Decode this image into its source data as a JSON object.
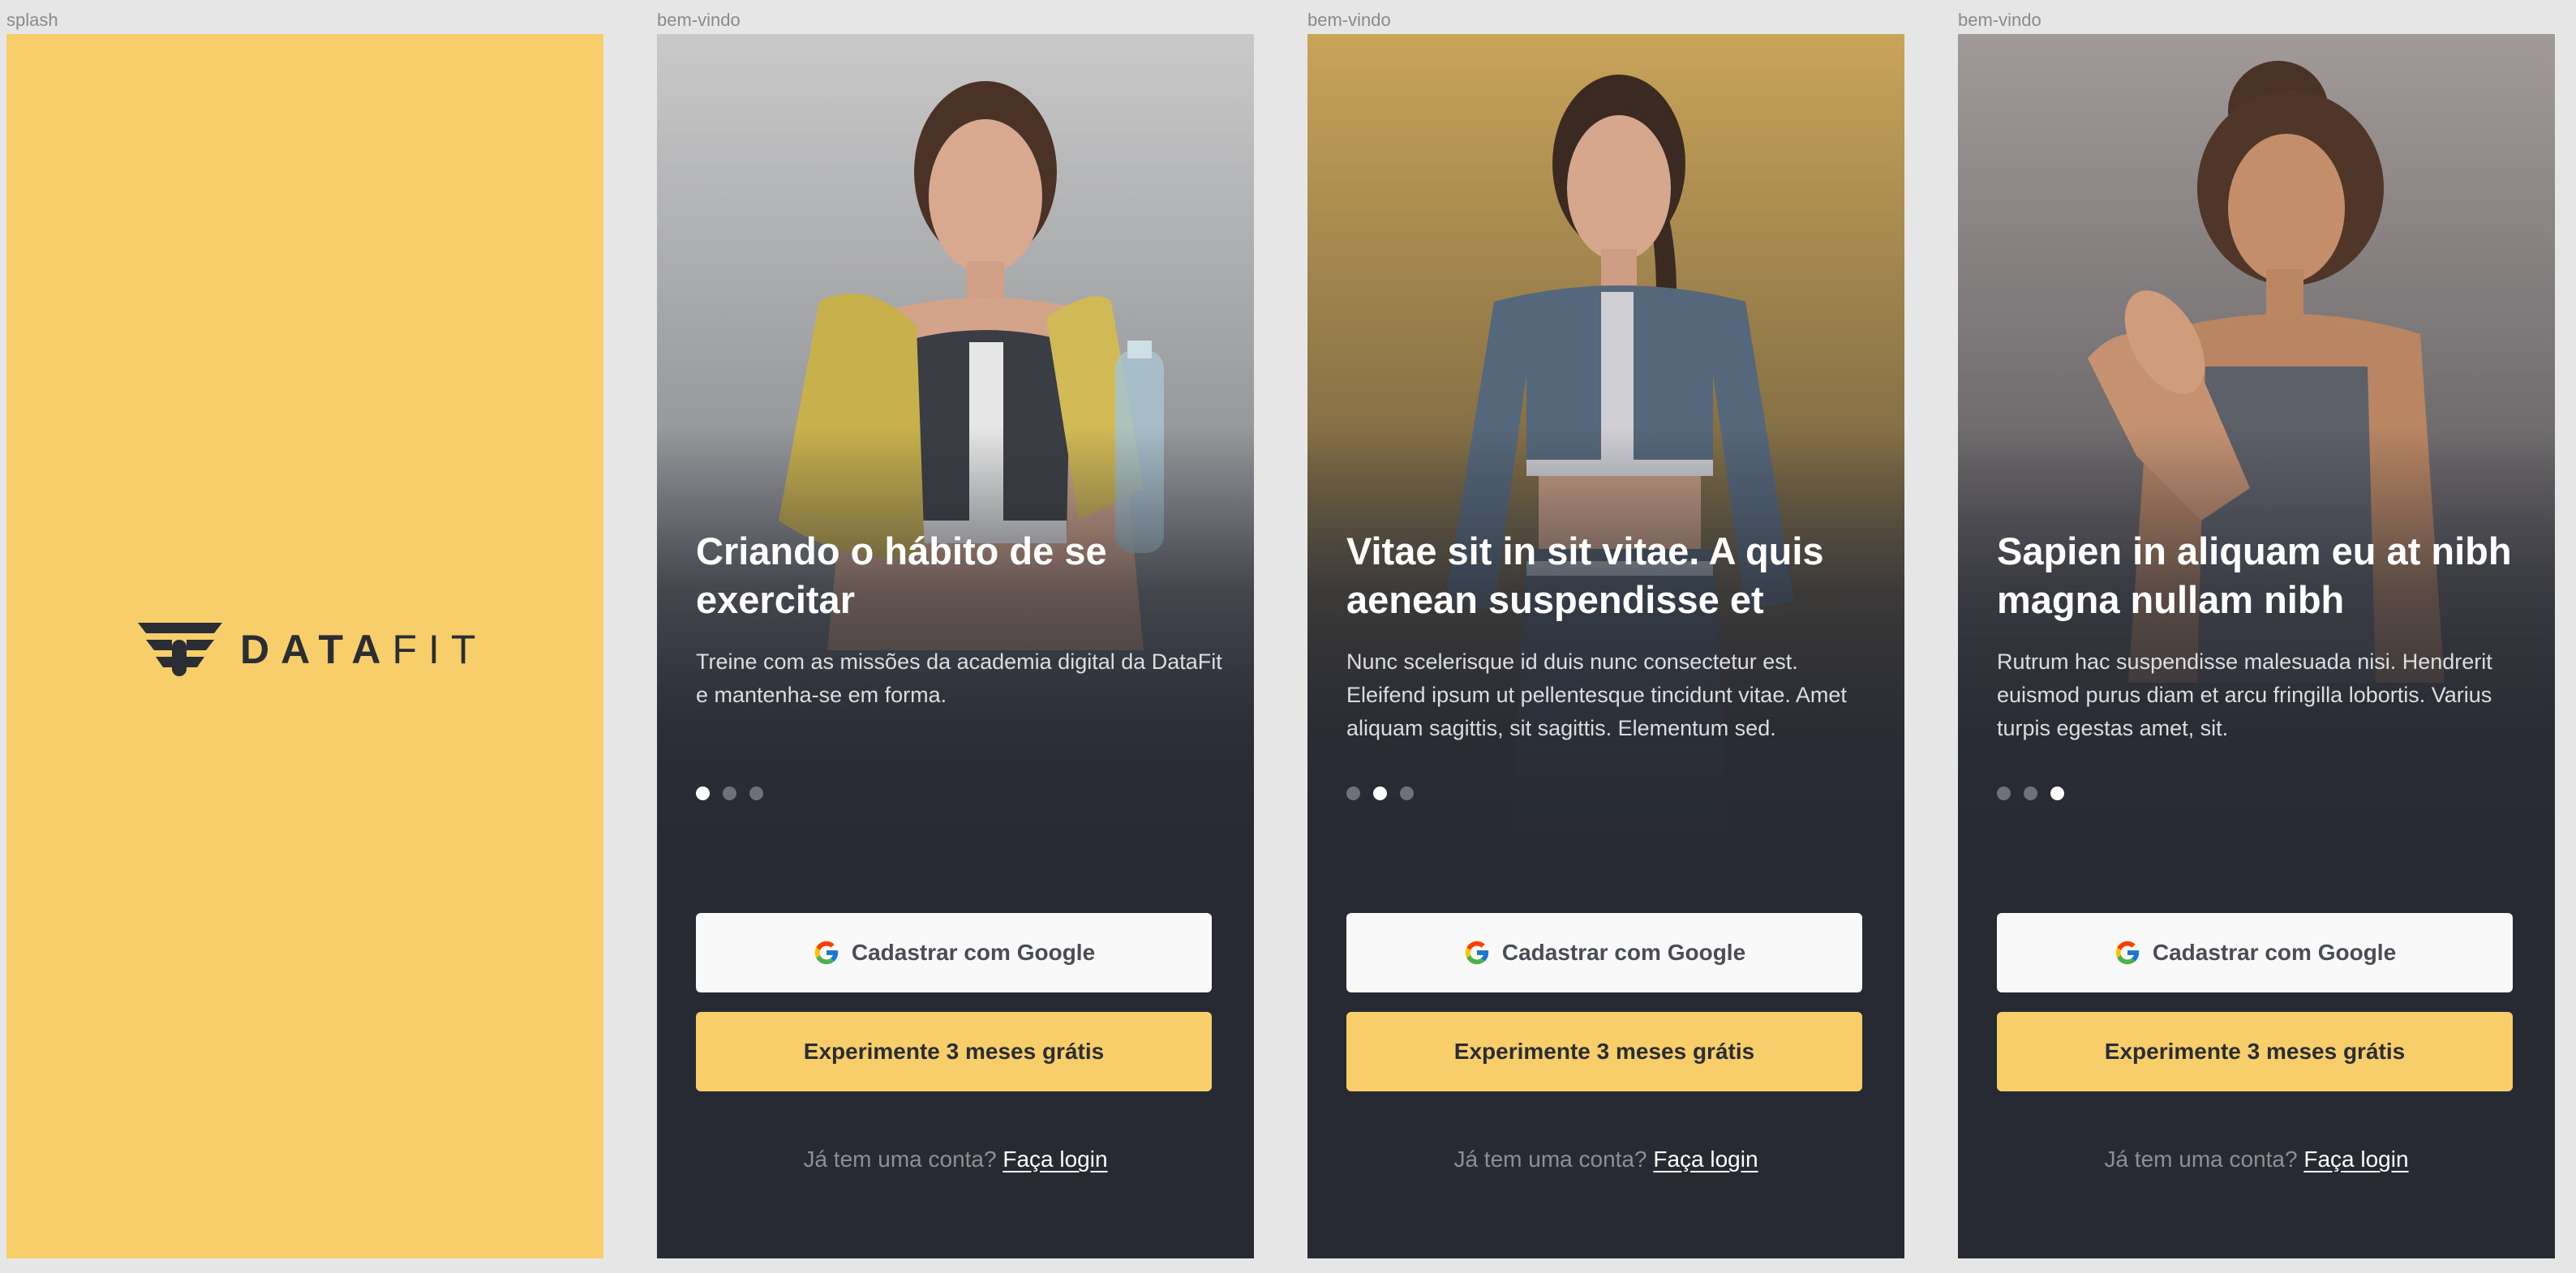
{
  "splash": {
    "label": "splash",
    "logo_bold": "DATA",
    "logo_light": "FIT"
  },
  "screens": [
    {
      "label": "bem-vindo",
      "title": "Criando o hábito de se exercitar",
      "description": "Treine com as missões da academia digital da DataFit e mantenha-se em forma.",
      "active_dot": 1,
      "google_button": "Cadastrar com Google",
      "trial_button": "Experimente 3 meses grátis",
      "login_prompt": "Já tem uma conta?",
      "login_link": "Faça login"
    },
    {
      "label": "bem-vindo",
      "title": "Vitae sit in sit vitae. A quis aenean suspendisse et",
      "description": "Nunc scelerisque id duis nunc consectetur est. Eleifend ipsum ut pellentesque tincidunt vitae. Amet aliquam sagittis, sit sagittis. Elementum sed.",
      "active_dot": 2,
      "google_button": "Cadastrar com Google",
      "trial_button": "Experimente 3 meses grátis",
      "login_prompt": "Já tem uma conta?",
      "login_link": "Faça login"
    },
    {
      "label": "bem-vindo",
      "title": "Sapien in aliquam eu at nibh magna nullam nibh",
      "description": "Rutrum hac suspendisse malesuada nisi. Hendrerit euismod purus diam et arcu fringilla lobortis. Varius turpis egestas amet, sit.",
      "active_dot": 3,
      "google_button": "Cadastrar com Google",
      "trial_button": "Experimente 3 meses grátis",
      "login_prompt": "Já tem uma conta?",
      "login_link": "Faça login"
    }
  ],
  "colors": {
    "brand_yellow": "#f8ce6a",
    "dark_background": "#272a33",
    "canvas": "#e6e6e6"
  },
  "icons": {
    "logo": "datafit-logo-icon",
    "google": "google-icon",
    "carousel": "pagination-dot-icon"
  }
}
